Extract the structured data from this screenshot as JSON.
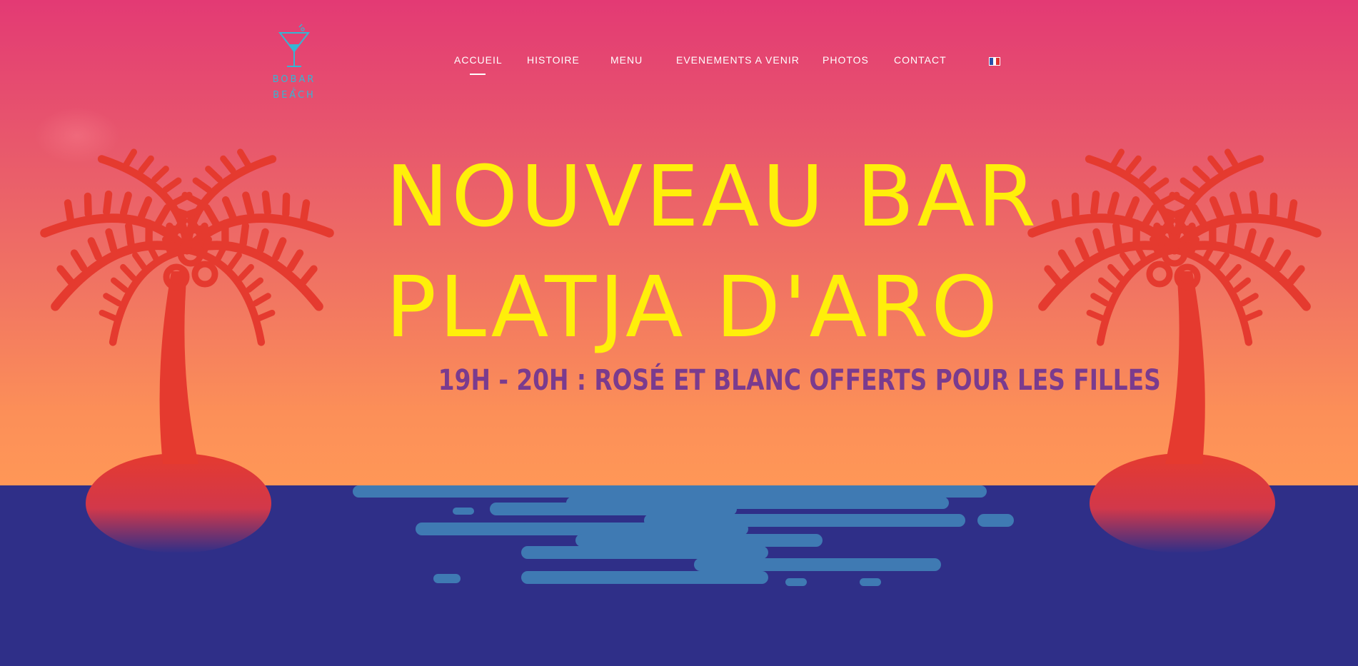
{
  "brand": {
    "logo_line1": "BOBAR",
    "logo_amp": "&",
    "logo_line2": "BEACH",
    "logo_icon": "cocktail-glass-icon",
    "logo_color": "#34b6d4"
  },
  "nav": {
    "items": [
      {
        "label": "ACCUEIL",
        "active": true
      },
      {
        "label": "HISTOIRE",
        "active": false
      },
      {
        "label": "MENU",
        "active": false
      },
      {
        "label": "EVENEMENTS A VENIR",
        "active": false
      },
      {
        "label": "PHOTOS",
        "active": false
      },
      {
        "label": "CONTACT",
        "active": false
      }
    ],
    "language_icon": "french-flag-icon"
  },
  "hero": {
    "title_line1": "NOUVEAU BAR",
    "title_line2": "PLATJA D'ARO",
    "subtitle": "19H - 20H : ROSÉ ET BLANC OFFERTS POUR LES FILLES",
    "title_color": "#ffef0a",
    "subtitle_color": "#7a3b8e",
    "palm_color": "#e53a2f",
    "sea_color": "#2f2f88",
    "reflection_color": "#3f7ab3"
  }
}
